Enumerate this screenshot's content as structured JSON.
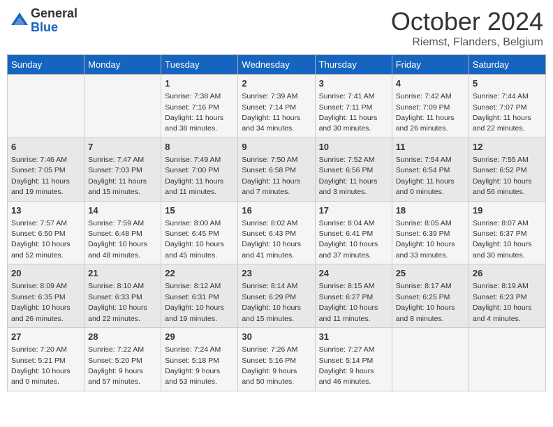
{
  "header": {
    "logo_general": "General",
    "logo_blue": "Blue",
    "title": "October 2024",
    "location": "Riemst, Flanders, Belgium"
  },
  "days_of_week": [
    "Sunday",
    "Monday",
    "Tuesday",
    "Wednesday",
    "Thursday",
    "Friday",
    "Saturday"
  ],
  "weeks": [
    [
      {
        "day": "",
        "info": ""
      },
      {
        "day": "",
        "info": ""
      },
      {
        "day": "1",
        "info": "Sunrise: 7:38 AM\nSunset: 7:16 PM\nDaylight: 11 hours and 38 minutes."
      },
      {
        "day": "2",
        "info": "Sunrise: 7:39 AM\nSunset: 7:14 PM\nDaylight: 11 hours and 34 minutes."
      },
      {
        "day": "3",
        "info": "Sunrise: 7:41 AM\nSunset: 7:11 PM\nDaylight: 11 hours and 30 minutes."
      },
      {
        "day": "4",
        "info": "Sunrise: 7:42 AM\nSunset: 7:09 PM\nDaylight: 11 hours and 26 minutes."
      },
      {
        "day": "5",
        "info": "Sunrise: 7:44 AM\nSunset: 7:07 PM\nDaylight: 11 hours and 22 minutes."
      }
    ],
    [
      {
        "day": "6",
        "info": "Sunrise: 7:46 AM\nSunset: 7:05 PM\nDaylight: 11 hours and 19 minutes."
      },
      {
        "day": "7",
        "info": "Sunrise: 7:47 AM\nSunset: 7:03 PM\nDaylight: 11 hours and 15 minutes."
      },
      {
        "day": "8",
        "info": "Sunrise: 7:49 AM\nSunset: 7:00 PM\nDaylight: 11 hours and 11 minutes."
      },
      {
        "day": "9",
        "info": "Sunrise: 7:50 AM\nSunset: 6:58 PM\nDaylight: 11 hours and 7 minutes."
      },
      {
        "day": "10",
        "info": "Sunrise: 7:52 AM\nSunset: 6:56 PM\nDaylight: 11 hours and 3 minutes."
      },
      {
        "day": "11",
        "info": "Sunrise: 7:54 AM\nSunset: 6:54 PM\nDaylight: 11 hours and 0 minutes."
      },
      {
        "day": "12",
        "info": "Sunrise: 7:55 AM\nSunset: 6:52 PM\nDaylight: 10 hours and 56 minutes."
      }
    ],
    [
      {
        "day": "13",
        "info": "Sunrise: 7:57 AM\nSunset: 6:50 PM\nDaylight: 10 hours and 52 minutes."
      },
      {
        "day": "14",
        "info": "Sunrise: 7:59 AM\nSunset: 6:48 PM\nDaylight: 10 hours and 48 minutes."
      },
      {
        "day": "15",
        "info": "Sunrise: 8:00 AM\nSunset: 6:45 PM\nDaylight: 10 hours and 45 minutes."
      },
      {
        "day": "16",
        "info": "Sunrise: 8:02 AM\nSunset: 6:43 PM\nDaylight: 10 hours and 41 minutes."
      },
      {
        "day": "17",
        "info": "Sunrise: 8:04 AM\nSunset: 6:41 PM\nDaylight: 10 hours and 37 minutes."
      },
      {
        "day": "18",
        "info": "Sunrise: 8:05 AM\nSunset: 6:39 PM\nDaylight: 10 hours and 33 minutes."
      },
      {
        "day": "19",
        "info": "Sunrise: 8:07 AM\nSunset: 6:37 PM\nDaylight: 10 hours and 30 minutes."
      }
    ],
    [
      {
        "day": "20",
        "info": "Sunrise: 8:09 AM\nSunset: 6:35 PM\nDaylight: 10 hours and 26 minutes."
      },
      {
        "day": "21",
        "info": "Sunrise: 8:10 AM\nSunset: 6:33 PM\nDaylight: 10 hours and 22 minutes."
      },
      {
        "day": "22",
        "info": "Sunrise: 8:12 AM\nSunset: 6:31 PM\nDaylight: 10 hours and 19 minutes."
      },
      {
        "day": "23",
        "info": "Sunrise: 8:14 AM\nSunset: 6:29 PM\nDaylight: 10 hours and 15 minutes."
      },
      {
        "day": "24",
        "info": "Sunrise: 8:15 AM\nSunset: 6:27 PM\nDaylight: 10 hours and 11 minutes."
      },
      {
        "day": "25",
        "info": "Sunrise: 8:17 AM\nSunset: 6:25 PM\nDaylight: 10 hours and 8 minutes."
      },
      {
        "day": "26",
        "info": "Sunrise: 8:19 AM\nSunset: 6:23 PM\nDaylight: 10 hours and 4 minutes."
      }
    ],
    [
      {
        "day": "27",
        "info": "Sunrise: 7:20 AM\nSunset: 5:21 PM\nDaylight: 10 hours and 0 minutes."
      },
      {
        "day": "28",
        "info": "Sunrise: 7:22 AM\nSunset: 5:20 PM\nDaylight: 9 hours and 57 minutes."
      },
      {
        "day": "29",
        "info": "Sunrise: 7:24 AM\nSunset: 5:18 PM\nDaylight: 9 hours and 53 minutes."
      },
      {
        "day": "30",
        "info": "Sunrise: 7:26 AM\nSunset: 5:16 PM\nDaylight: 9 hours and 50 minutes."
      },
      {
        "day": "31",
        "info": "Sunrise: 7:27 AM\nSunset: 5:14 PM\nDaylight: 9 hours and 46 minutes."
      },
      {
        "day": "",
        "info": ""
      },
      {
        "day": "",
        "info": ""
      }
    ]
  ]
}
